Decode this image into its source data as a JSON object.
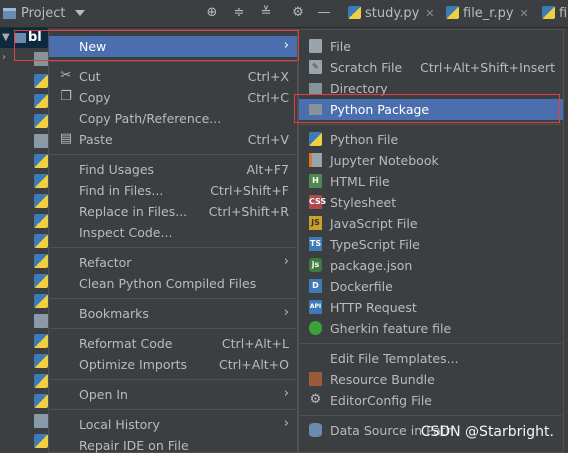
{
  "toolbar": {
    "project_label": "Project",
    "tabs": [
      {
        "label": "study.py"
      },
      {
        "label": "file_r.py"
      },
      {
        "label": "fil"
      }
    ]
  },
  "tree": {
    "root_label": "bl"
  },
  "context_menu": {
    "items": [
      {
        "key": "new",
        "label": "New"
      },
      {
        "key": "cut",
        "label": "Cut",
        "shortcut": "Ctrl+X"
      },
      {
        "key": "copy",
        "label": "Copy",
        "shortcut": "Ctrl+C"
      },
      {
        "key": "copy_path",
        "label": "Copy Path/Reference..."
      },
      {
        "key": "paste",
        "label": "Paste",
        "shortcut": "Ctrl+V"
      },
      {
        "key": "find_usages",
        "label": "Find Usages",
        "shortcut": "Alt+F7"
      },
      {
        "key": "find_in_files",
        "label": "Find in Files...",
        "shortcut": "Ctrl+Shift+F"
      },
      {
        "key": "replace_in_files",
        "label": "Replace in Files...",
        "shortcut": "Ctrl+Shift+R"
      },
      {
        "key": "inspect_code",
        "label": "Inspect Code..."
      },
      {
        "key": "refactor",
        "label": "Refactor"
      },
      {
        "key": "clean_compiled",
        "label": "Clean Python Compiled Files"
      },
      {
        "key": "bookmarks",
        "label": "Bookmarks"
      },
      {
        "key": "reformat_code",
        "label": "Reformat Code",
        "shortcut": "Ctrl+Alt+L"
      },
      {
        "key": "optimize_imports",
        "label": "Optimize Imports",
        "shortcut": "Ctrl+Alt+O"
      },
      {
        "key": "open_in",
        "label": "Open In"
      },
      {
        "key": "local_history",
        "label": "Local History"
      },
      {
        "key": "repair_ide",
        "label": "Repair IDE on File"
      }
    ]
  },
  "new_submenu": {
    "items": [
      {
        "key": "file",
        "label": "File",
        "icon": "file-icon"
      },
      {
        "key": "scratch_file",
        "label": "Scratch File",
        "shortcut": "Ctrl+Alt+Shift+Insert",
        "icon": "scratch-file-icon"
      },
      {
        "key": "directory",
        "label": "Directory",
        "icon": "folder-icon"
      },
      {
        "key": "python_package",
        "label": "Python Package",
        "icon": "package-icon"
      },
      {
        "key": "python_file",
        "label": "Python File",
        "icon": "python-icon"
      },
      {
        "key": "jupyter_notebook",
        "label": "Jupyter Notebook",
        "icon": "jupyter-icon"
      },
      {
        "key": "html_file",
        "label": "HTML File",
        "icon": "html-icon"
      },
      {
        "key": "stylesheet",
        "label": "Stylesheet",
        "icon": "css-icon"
      },
      {
        "key": "javascript_file",
        "label": "JavaScript File",
        "icon": "javascript-icon"
      },
      {
        "key": "typescript_file",
        "label": "TypeScript File",
        "icon": "typescript-icon"
      },
      {
        "key": "package_json",
        "label": "package.json",
        "icon": "nodejs-icon"
      },
      {
        "key": "dockerfile",
        "label": "Dockerfile",
        "icon": "docker-icon"
      },
      {
        "key": "http_request",
        "label": "HTTP Request",
        "icon": "api-icon"
      },
      {
        "key": "gherkin_file",
        "label": "Gherkin feature file",
        "icon": "gherkin-icon"
      },
      {
        "key": "edit_templates",
        "label": "Edit File Templates..."
      },
      {
        "key": "resource_bundle",
        "label": "Resource Bundle",
        "icon": "resource-bundle-icon"
      },
      {
        "key": "editorconfig",
        "label": "EditorConfig File",
        "icon": "gear-icon"
      },
      {
        "key": "data_source",
        "label": "Data Source in Path",
        "icon": "database-icon"
      }
    ]
  },
  "watermark": "CSDN @Starbright.",
  "colors": {
    "background": "#3c3f41",
    "selection": "#4b6eaf",
    "highlight_box": "#e04040",
    "text": "#bbbbbb"
  }
}
